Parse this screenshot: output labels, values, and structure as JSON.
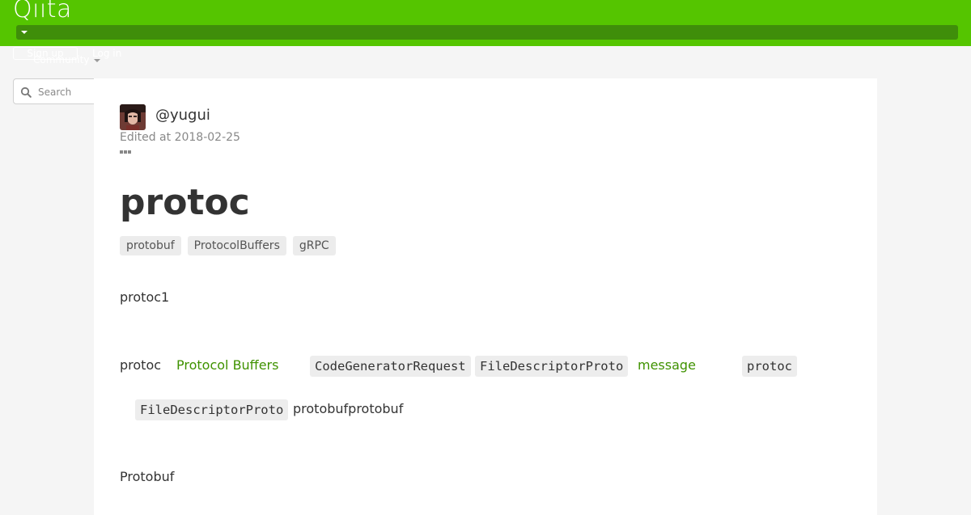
{
  "header": {
    "logo": "Qiita",
    "signup_label": "Sign up",
    "login_label": "Log in",
    "community_label": "Community",
    "brand_color": "#55c500"
  },
  "search": {
    "placeholder": "Search",
    "value": ""
  },
  "article": {
    "author": "@yugui",
    "edited": "Edited at 2018-02-25",
    "title": "protoc",
    "tags": [
      "protobuf",
      "ProtocolBuffers",
      "gRPC"
    ],
    "paragraphs": {
      "p1": "protoc1",
      "p2": {
        "t1": "protoc",
        "link1": "Protocol Buffers",
        "code1": "CodeGeneratorRequest",
        "code2": "FileDescriptorProto",
        "link2": "message",
        "code3": "protoc"
      },
      "p3": {
        "code1": "FileDescriptorProto",
        "t1": "protobufprotobuf"
      },
      "p4": "Protobuf"
    }
  }
}
